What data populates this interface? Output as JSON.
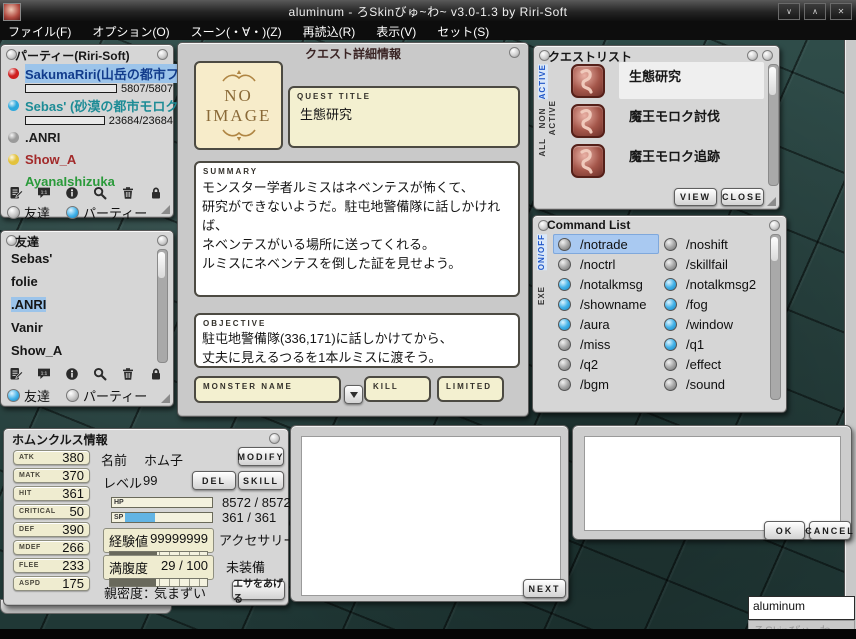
{
  "window": {
    "title": "aluminum - ろSkinびゅ~わ~ v3.0-1.3 by Riri-Soft",
    "controls": [
      {
        "name": "shade-button",
        "glyph": "∨"
      },
      {
        "name": "unshade-button",
        "glyph": "∧"
      },
      {
        "name": "close-button",
        "glyph": "✕"
      }
    ]
  },
  "menu": {
    "items": [
      "ファイル(F)",
      "オプション(O)",
      "スーン(・∀・)(Z)",
      "再読込(R)",
      "表示(V)",
      "セット(S)"
    ]
  },
  "party_panel": {
    "title": "パーティー(Riri-Soft)",
    "members": [
      {
        "name": "SakumaRiri(山岳の都市フェ",
        "status_color": "#cf2020",
        "name_color": "#123c8c",
        "selected": true,
        "hp": "5807/5807"
      },
      {
        "name": "Sebas' (砂漠の都市モロク)",
        "status_color": "#2da8dc",
        "name_color": "#1d8c96",
        "selected": false,
        "hp": "23684/23684"
      },
      {
        "name": ".ANRI",
        "status_color": "#9a9a9a",
        "name_color": "#1c1c1c",
        "selected": false,
        "hp": null
      },
      {
        "name": "Show_A",
        "status_color": "#e3c23c",
        "name_color": "#a22a2a",
        "selected": false,
        "hp": null
      },
      {
        "name": "AyanaIshizuka",
        "status_color": null,
        "name_color": "#2a9a3a",
        "selected": false,
        "hp": null
      }
    ],
    "tabs": [
      {
        "label": "友達",
        "active": false
      },
      {
        "label": "パーティー",
        "active": true
      }
    ]
  },
  "friends_panel": {
    "title": "友達",
    "friends": [
      {
        "name": "Sebas'",
        "selected": false
      },
      {
        "name": "folie",
        "selected": false
      },
      {
        "name": ".ANRI",
        "selected": true
      },
      {
        "name": "Vanir",
        "selected": false
      },
      {
        "name": "Show_A",
        "selected": false
      }
    ],
    "tabs": [
      {
        "label": "友達",
        "active": true
      },
      {
        "label": "パーティー",
        "active": false
      }
    ]
  },
  "social_icons": [
    {
      "name": "edit-note-icon"
    },
    {
      "name": "chat-1to1-icon",
      "badge": "1:1"
    },
    {
      "name": "info-icon"
    },
    {
      "name": "search-icon"
    },
    {
      "name": "trash-icon"
    },
    {
      "name": "lock-icon"
    }
  ],
  "quest_detail": {
    "title": "クエスト詳細情報",
    "no_image_line1": "NO",
    "no_image_line2": "IMAGE",
    "quest_title_label": "QUEST TITLE",
    "quest_title": "生態研究",
    "summary_label": "SUMMARY",
    "summary_lines": [
      "モンスター学者ルミスはネベンテスが怖くて、",
      "研究ができないようだ。駐屯地警備隊に話しかければ、",
      "ネベンテスがいる場所に送ってくれる。",
      "ルミスにネベンテスを倒した証を見せよう。"
    ],
    "objective_label": "OBJECTIVE",
    "objective_lines": [
      "駐屯地警備隊(336,171)に話しかけてから、",
      "丈夫に見えるつるを1本ルミスに渡そう。"
    ],
    "monster_name_label": "MONSTER NAME",
    "monster_name_value": "",
    "kill_label": "KILL",
    "limited_label": "LIMITED"
  },
  "quest_list": {
    "title": "クエストリスト",
    "tabs": [
      {
        "label": "ACTIVE",
        "active": true
      },
      {
        "label": "NON\nACTIVE",
        "active": false
      },
      {
        "label": "ALL",
        "active": false
      }
    ],
    "quests": [
      {
        "name": "生態研究",
        "selected": true
      },
      {
        "name": "魔王モロク討伐",
        "selected": false
      },
      {
        "name": "魔王モロク追跡",
        "selected": false
      }
    ],
    "view_button": "VIEW",
    "close_button": "CLOSE"
  },
  "command_list": {
    "title": "Command List",
    "tabs": [
      {
        "label": "ON/OFF",
        "active": true
      },
      {
        "label": "EXE",
        "active": false
      }
    ],
    "commands": [
      {
        "label": "/notrade",
        "on": false,
        "selected": true
      },
      {
        "label": "/noshift",
        "on": false,
        "selected": false
      },
      {
        "label": "/noctrl",
        "on": false,
        "selected": false
      },
      {
        "label": "/skillfail",
        "on": false,
        "selected": false
      },
      {
        "label": "/notalkmsg",
        "on": true,
        "selected": false
      },
      {
        "label": "/notalkmsg2",
        "on": true,
        "selected": false
      },
      {
        "label": "/showname",
        "on": true,
        "selected": false
      },
      {
        "label": "/fog",
        "on": true,
        "selected": false
      },
      {
        "label": "/aura",
        "on": true,
        "selected": false
      },
      {
        "label": "/window",
        "on": true,
        "selected": false
      },
      {
        "label": "/miss",
        "on": false,
        "selected": false
      },
      {
        "label": "/q1",
        "on": true,
        "selected": false
      },
      {
        "label": "/q2",
        "on": false,
        "selected": false
      },
      {
        "label": "/effect",
        "on": false,
        "selected": false
      },
      {
        "label": "/bgm",
        "on": false,
        "selected": false
      },
      {
        "label": "/sound",
        "on": false,
        "selected": false
      }
    ]
  },
  "homunculus": {
    "title": "ホムンクルス情報",
    "stats": [
      {
        "label": "ATK",
        "value": "380"
      },
      {
        "label": "MATK",
        "value": "370"
      },
      {
        "label": "HIT",
        "value": "361"
      },
      {
        "label": "CRITICAL",
        "value": "50"
      },
      {
        "label": "DEF",
        "value": "390"
      },
      {
        "label": "MDEF",
        "value": "266"
      },
      {
        "label": "FLEE",
        "value": "233"
      },
      {
        "label": "ASPD",
        "value": "175"
      }
    ],
    "name_label": "名前",
    "name_value": "ホム子",
    "modify_button": "MODIFY",
    "level_label": "レベル",
    "level_value": "99",
    "del_button": "DEL",
    "skill_button": "SKILL",
    "hp_label": "HP",
    "hp_value": "8572 / 8572",
    "hp_percent": 55,
    "sp_label": "SP",
    "sp_value": "361 / 361",
    "sp_percent": 34,
    "exp_label": "経験値",
    "exp_value": "99999999",
    "exp_percent": 48,
    "satiety_label": "満腹度",
    "satiety_value": "29 / 100",
    "satiety_percent": 47,
    "accessory_label": "アクセサリー",
    "accessory_value": "未装備",
    "intimacy_label": "親密度：",
    "intimacy_value": "気まずい",
    "feed_button": "エサをあげる"
  },
  "next_dialog": {
    "next_button": "NEXT"
  },
  "confirm_dialog": {
    "ok_button": "OK",
    "cancel_button": "CANCEL"
  },
  "skin_selector": {
    "value": "aluminum",
    "caption": "ろSkinびゅ~わ~"
  },
  "colors": {
    "bar_green": "#35d435",
    "orb_on": "#35a8e0",
    "hp_fill": "#69695c",
    "sp_fill": "#62b4e4",
    "highlight_blue": "#9cc4ea"
  }
}
